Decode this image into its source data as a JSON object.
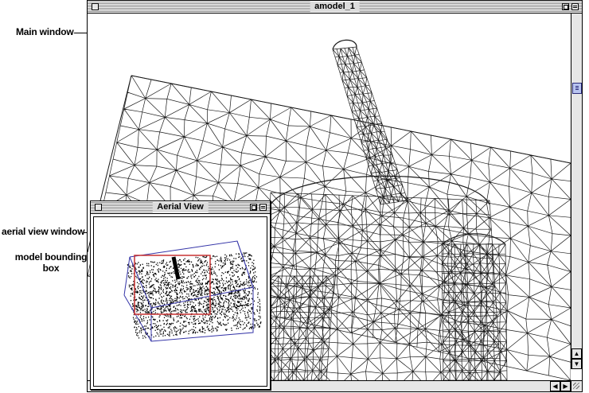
{
  "main_window": {
    "title": "amodel_1"
  },
  "aerial_window": {
    "title": "Aerial View"
  },
  "callouts": {
    "main_window": "Main window",
    "aerial_view_window": "aerial view window",
    "model_bounding_box_line1": "model bounding",
    "model_bounding_box_line2": "box"
  },
  "colors": {
    "mesh": "#1a1a1a",
    "bounding_box": "#3535a8",
    "view_rect": "#c83232",
    "scroll_thumb": "#b8c4f0"
  },
  "icons": {
    "close": "close-box-icon",
    "zoom": "zoom-box-icon",
    "collapse": "collapse-box-icon",
    "scroll_up": "scroll-up-arrow-icon",
    "scroll_down": "scroll-down-arrow-icon",
    "scroll_left": "scroll-left-arrow-icon",
    "scroll_right": "scroll-right-arrow-icon",
    "grow": "resize-grip-icon"
  }
}
